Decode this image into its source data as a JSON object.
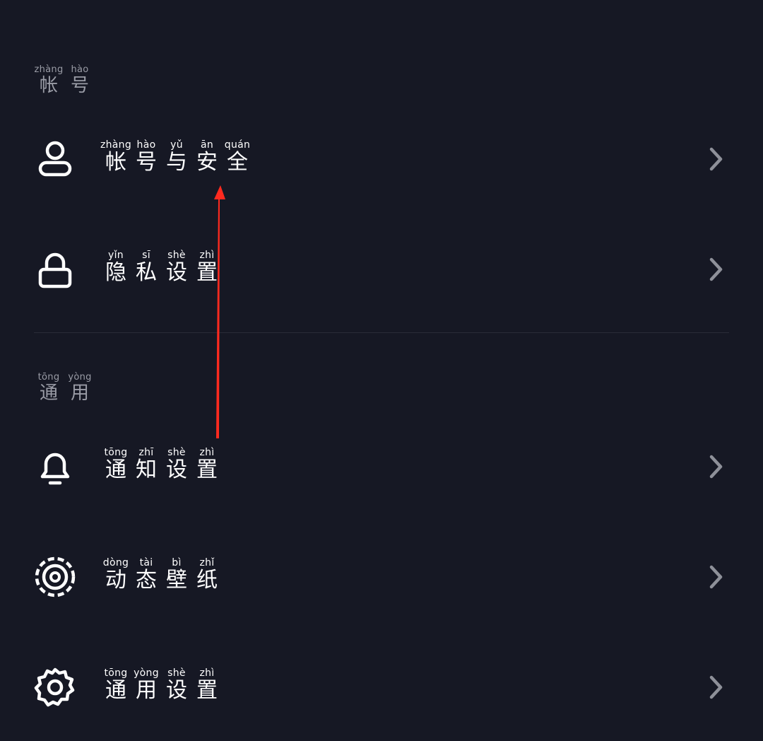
{
  "sections": [
    {
      "header": [
        {
          "py": "zhàng",
          "hz": "帐"
        },
        {
          "py": "hào",
          "hz": "号"
        }
      ]
    },
    {
      "header": [
        {
          "py": "tōng",
          "hz": "通"
        },
        {
          "py": "yòng",
          "hz": "用"
        }
      ]
    }
  ],
  "items": [
    {
      "icon": "person-icon",
      "label": [
        {
          "py": "zhàng",
          "hz": "帐"
        },
        {
          "py": "hào",
          "hz": "号"
        },
        {
          "py": "yǔ",
          "hz": "与"
        },
        {
          "py": "ān",
          "hz": "安"
        },
        {
          "py": "quán",
          "hz": "全"
        }
      ]
    },
    {
      "icon": "lock-icon",
      "label": [
        {
          "py": "yǐn",
          "hz": "隐"
        },
        {
          "py": "sī",
          "hz": "私"
        },
        {
          "py": "shè",
          "hz": "设"
        },
        {
          "py": "zhì",
          "hz": "置"
        }
      ]
    },
    {
      "icon": "bell-icon",
      "label": [
        {
          "py": "tōng",
          "hz": "通"
        },
        {
          "py": "zhī",
          "hz": "知"
        },
        {
          "py": "shè",
          "hz": "设"
        },
        {
          "py": "zhì",
          "hz": "置"
        }
      ]
    },
    {
      "icon": "wallpaper-icon",
      "label": [
        {
          "py": "dòng",
          "hz": "动"
        },
        {
          "py": "tài",
          "hz": "态"
        },
        {
          "py": "bì",
          "hz": "壁"
        },
        {
          "py": "zhǐ",
          "hz": "纸"
        }
      ]
    },
    {
      "icon": "gear-icon",
      "label": [
        {
          "py": "tōng",
          "hz": "通"
        },
        {
          "py": "yòng",
          "hz": "用"
        },
        {
          "py": "shè",
          "hz": "设"
        },
        {
          "py": "zhì",
          "hz": "置"
        }
      ]
    }
  ],
  "colors": {
    "background": "#161824",
    "text": "#ffffff",
    "section_header": "#9a9ca6",
    "chevron": "#8e9099",
    "annotation_arrow": "#ff2a1f"
  }
}
